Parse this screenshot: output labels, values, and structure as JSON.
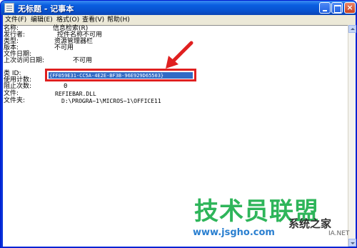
{
  "window": {
    "title": "无标题 - 记事本"
  },
  "menu": [
    "文件(F)",
    "编辑(E)",
    "格式(O)",
    "查看(V)",
    "帮助(H)"
  ],
  "content": {
    "name": {
      "key": "名称:",
      "value": "信息检索(R)"
    },
    "publisher": {
      "key": "发行者:",
      "value": "控件名称不可用"
    },
    "type": {
      "key": "类型:",
      "value": "资源管理器栏"
    },
    "version": {
      "key": "版本:",
      "value": "不可用"
    },
    "file_date": {
      "key": "文件日期:",
      "value": ""
    },
    "last_access": {
      "key": "上次访问日期:",
      "value": "不可用"
    },
    "class_id": {
      "key": "类 ID:",
      "value": "{FF059E31-CC5A-4E2E-BF3B-96E929D65503}"
    },
    "use_count": {
      "key": "使用计数:",
      "value": ""
    },
    "block_count": {
      "key": "阻止次数:",
      "value": "0"
    },
    "file": {
      "key": "文件:",
      "value": "REFIEBAR.DLL"
    },
    "folder": {
      "key": "文件夹:",
      "value": "D:\\PROGRA~1\\MICROS~1\\OFFICE11"
    }
  },
  "watermark": {
    "main": "技术员联盟",
    "url": "www.jsgho.com",
    "sys": "系统之家",
    "net": "IA.NET"
  },
  "colors": {
    "highlight_box": "#e02020",
    "selection": "#316ac5",
    "watermark_green": "#2eb55a"
  }
}
